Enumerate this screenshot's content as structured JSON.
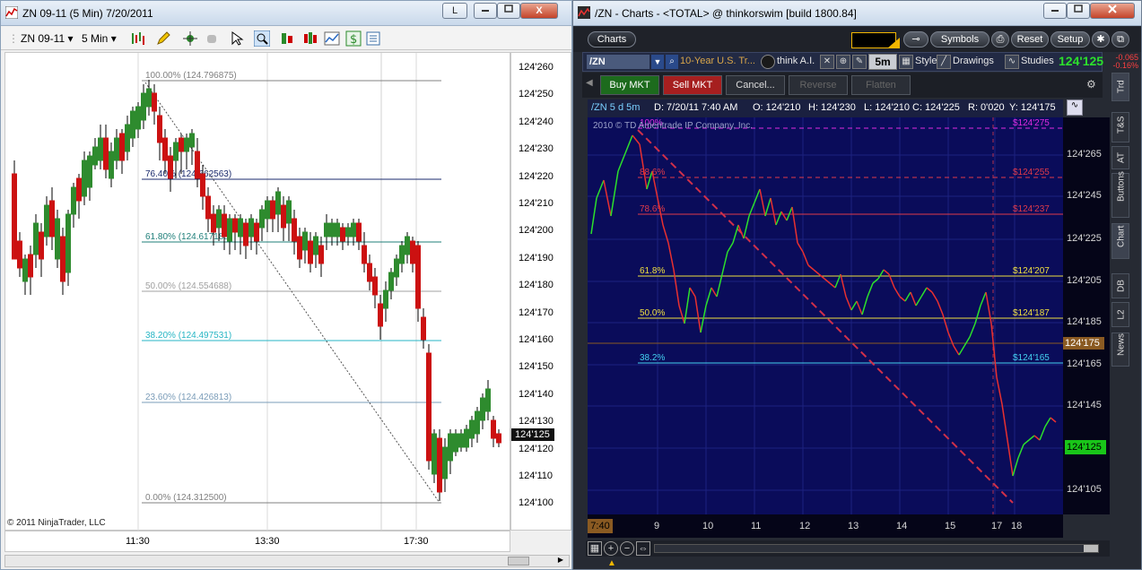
{
  "ninja": {
    "title": "ZN 09-11 (5 Min)  7/20/2011",
    "window_buttons": {
      "help": "L",
      "min": "",
      "max": "",
      "close": "X"
    },
    "toolbar": {
      "instrument": "ZN 09-11",
      "interval": "5 Min"
    },
    "copyright": "© 2011 NinjaTrader, LLC",
    "price_labels": [
      "124'260",
      "124'250",
      "124'240",
      "124'230",
      "124'220",
      "124'210",
      "124'200",
      "124'190",
      "124'180",
      "124'170",
      "124'160",
      "124'150",
      "124'140",
      "124'130",
      "124'120",
      "124'110",
      "124'100"
    ],
    "current_price": "124'125",
    "time_labels": [
      "11:30",
      "13:30",
      "17:30"
    ],
    "fib_levels": [
      {
        "label": "100.00% (124.796875)",
        "color": "#808080"
      },
      {
        "label": "76.40% (124.662563)",
        "color": "#1a2a6c"
      },
      {
        "label": "61.80% (124.617188)",
        "color": "#1f7f7a"
      },
      {
        "label": "50.00% (124.554688)",
        "color": "#a0a0a0"
      },
      {
        "label": "38.20% (124.497531)",
        "color": "#26b5c4"
      },
      {
        "label": "23.60% (124.426813)",
        "color": "#7a9cb8"
      },
      {
        "label": "0.00% (124.312500)",
        "color": "#808080"
      }
    ],
    "colors": {
      "up": "#2e8b2e",
      "down": "#cc1111"
    }
  },
  "tos": {
    "title": "/ZN - Charts - <TOTAL> @ thinkorswim [build 1800.84]",
    "top_buttons": {
      "charts": "Charts",
      "symbols": "Symbols",
      "reset": "Reset",
      "setup": "Setup"
    },
    "symbol": "/ZN",
    "description": "10-Year U.S. Tr...",
    "think_ai": "think A.I.",
    "interval": "5m",
    "style": "Style",
    "drawings": "Drawings",
    "studies": "Studies",
    "last": "124'125",
    "change": "-0.065",
    "change_pct": "-0.16%",
    "orders": {
      "buy": "Buy MKT",
      "sell": "Sell MKT",
      "cancel": "Cancel...",
      "reverse": "Reverse",
      "flatten": "Flatten"
    },
    "quote_bar": {
      "symbol": "/ZN 5 d 5m",
      "date": "D: 7/20/11 7:40 AM",
      "open": "O: 124'210",
      "high": "H: 124'230",
      "low": "L: 124'210",
      "close": "C: 124'225",
      "range": "R: 0'020",
      "y": "Y: 124'175"
    },
    "copyright": "2010 © TD Ameritrade IP Company, Inc.",
    "price_labels": [
      "124'265",
      "124'245",
      "124'225",
      "124'205",
      "124'185",
      "124'165",
      "124'145",
      "124'125",
      "124'105"
    ],
    "y_marker": "124'175",
    "current_price": "124'125",
    "time_start": "7:40",
    "time_labels": [
      "9",
      "10",
      "11",
      "12",
      "13",
      "14",
      "15",
      "17",
      "18"
    ],
    "fib_levels": [
      {
        "pct": "100%",
        "price": "$124'275",
        "color": "#e02be0"
      },
      {
        "pct": "88.6%",
        "price": "$124'255",
        "color": "#e03a4a"
      },
      {
        "pct": "78.6%",
        "price": "$124'237",
        "color": "#e03a4a"
      },
      {
        "pct": "61.8%",
        "price": "$124'207",
        "color": "#f0e040"
      },
      {
        "pct": "50.0%",
        "price": "$124'187",
        "color": "#f0e040"
      },
      {
        "pct": "38.2%",
        "price": "$124'165",
        "color": "#44d0f0"
      }
    ],
    "side_tabs": [
      "Trd",
      "T&S",
      "AT",
      "Buttons",
      "Chart",
      "DB",
      "L2",
      "News"
    ]
  }
}
